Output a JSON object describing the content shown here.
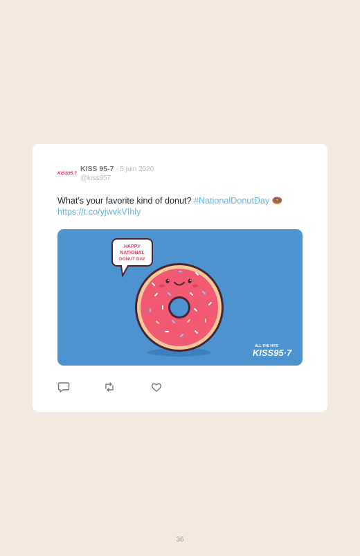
{
  "tweet": {
    "display_name": "KISS 95-7",
    "separator": " · ",
    "date": "5 juin 2020",
    "handle": "@kiss957",
    "text": "What's your favorite kind of donut? ",
    "hashtag": "#NationalDonutDay",
    "emoji": "🍩",
    "link": "https://t.co/yjwvkVIhly",
    "avatar_logo_text": "KISS95.7"
  },
  "media": {
    "bubble_line1": "HAPPY",
    "bubble_line2": "NATIONAL",
    "bubble_line3": "DONUT DAY",
    "logo_tagline": "ALL THE HITS",
    "logo_text": "KISS95·7",
    "background_color": "#4d93cf",
    "frosting_color": "#f25a74"
  },
  "actions": {
    "reply_icon": "reply-icon",
    "retweet_icon": "retweet-icon",
    "like_icon": "heart-icon"
  },
  "page": {
    "number": "36"
  }
}
